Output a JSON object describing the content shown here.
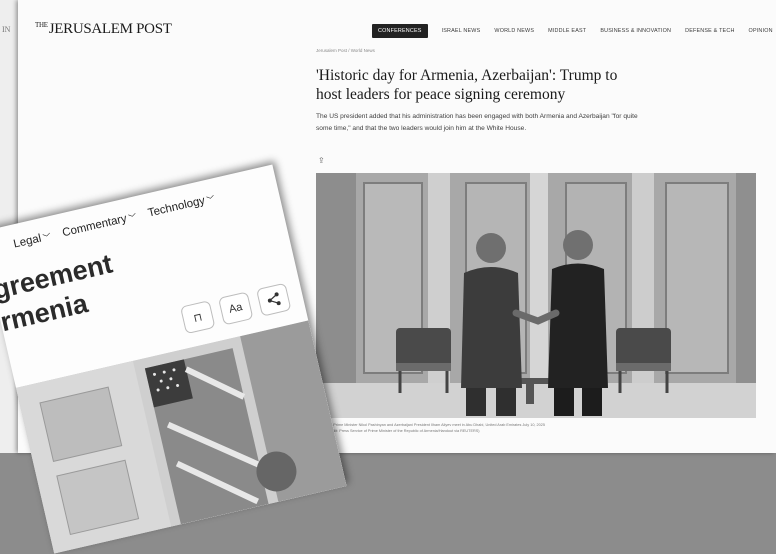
{
  "jp": {
    "edge_text": "IN",
    "logo_the": "THE",
    "logo": "JERUSALEM POST",
    "nav": [
      "CONFERENCES",
      "ISRAEL NEWS",
      "WORLD NEWS",
      "MIDDLE EAST",
      "BUSINESS & INNOVATION",
      "DEFENSE & TECH",
      "OPINION"
    ],
    "breadcrumb": "Jerusalem Post / World News",
    "headline": "'Historic day for Armenia, Azerbaijan': Trump to host leaders for peace signing ceremony",
    "subhead": "The US president added that his administration has been engaged with both Armenia and Azerbaijan \"for quite some time,\" and that the two leaders would join him at the White House.",
    "share_glyph": "⇪",
    "caption_1": "Armenian Prime Minister Nikol Pashinyan and Azerbaijani President Ilham Aliyev meet in Abu Dhabi, United Arab Emirates July 10, 2025",
    "caption_2": "(photo credit: Press Service of Prime Minister of the Republic of Armenia/Handout via REUTERS)"
  },
  "card": {
    "nav": [
      "Legal",
      "Commentary",
      "Technology"
    ],
    "headline_1": "greement",
    "headline_2": "rmenia",
    "buttons": [
      {
        "icon": "bookmark-icon",
        "label": "⊓"
      },
      {
        "icon": "text-size-icon",
        "label": "Aa"
      },
      {
        "icon": "share-icon",
        "label": "<"
      }
    ]
  }
}
